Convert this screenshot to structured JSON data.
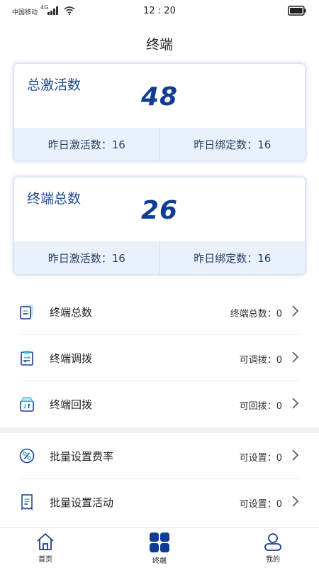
{
  "status_bar": {
    "carrier": "中国移动",
    "network": "4G",
    "time": "12 : 20"
  },
  "page": {
    "title": "终端"
  },
  "cards": [
    {
      "label": "总激活数",
      "value": "48",
      "stats": [
        {
          "text": "昨日激活数：16"
        },
        {
          "text": "昨日绑定数：16"
        }
      ]
    },
    {
      "label": "终端总数",
      "value": "26",
      "stats": [
        {
          "text": "昨日激活数：16"
        },
        {
          "text": "昨日绑定数：16"
        }
      ]
    }
  ],
  "menu": [
    {
      "icon": "document-list-icon",
      "label": "终端总数",
      "value": "终端总数：0"
    },
    {
      "icon": "clipboard-transfer-icon",
      "label": "终端调拨",
      "value": "可调拨：0"
    },
    {
      "icon": "box-return-icon",
      "label": "终端回拨",
      "value": "可回拨：0"
    },
    {
      "icon": "percent-icon",
      "label": "批量设置费率",
      "value": "可设置：0"
    },
    {
      "icon": "receipt-icon",
      "label": "批量设置活动",
      "value": "可设置：0"
    }
  ],
  "tabs": [
    {
      "icon": "home-icon",
      "label": "首页",
      "active": false
    },
    {
      "icon": "grid-icon",
      "label": "终端",
      "active": true
    },
    {
      "icon": "user-icon",
      "label": "我的",
      "active": false
    }
  ],
  "colors": {
    "brand_blue": "#0f3d95",
    "card_label": "#1f4a96",
    "card_footer_bg": "#e9f1fc",
    "icon_cyan": "#3ab7e8",
    "icon_navy": "#1d3f8f"
  }
}
